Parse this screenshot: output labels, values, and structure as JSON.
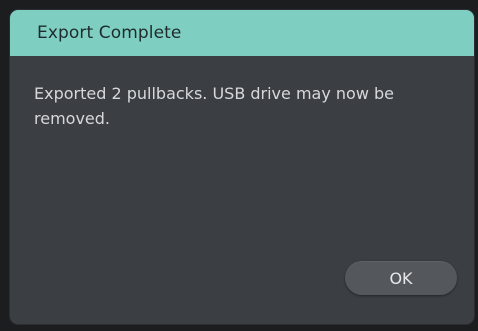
{
  "dialog": {
    "title": "Export Complete",
    "message": "Exported 2 pullbacks. USB drive may now be removed.",
    "ok_label": "OK"
  }
}
